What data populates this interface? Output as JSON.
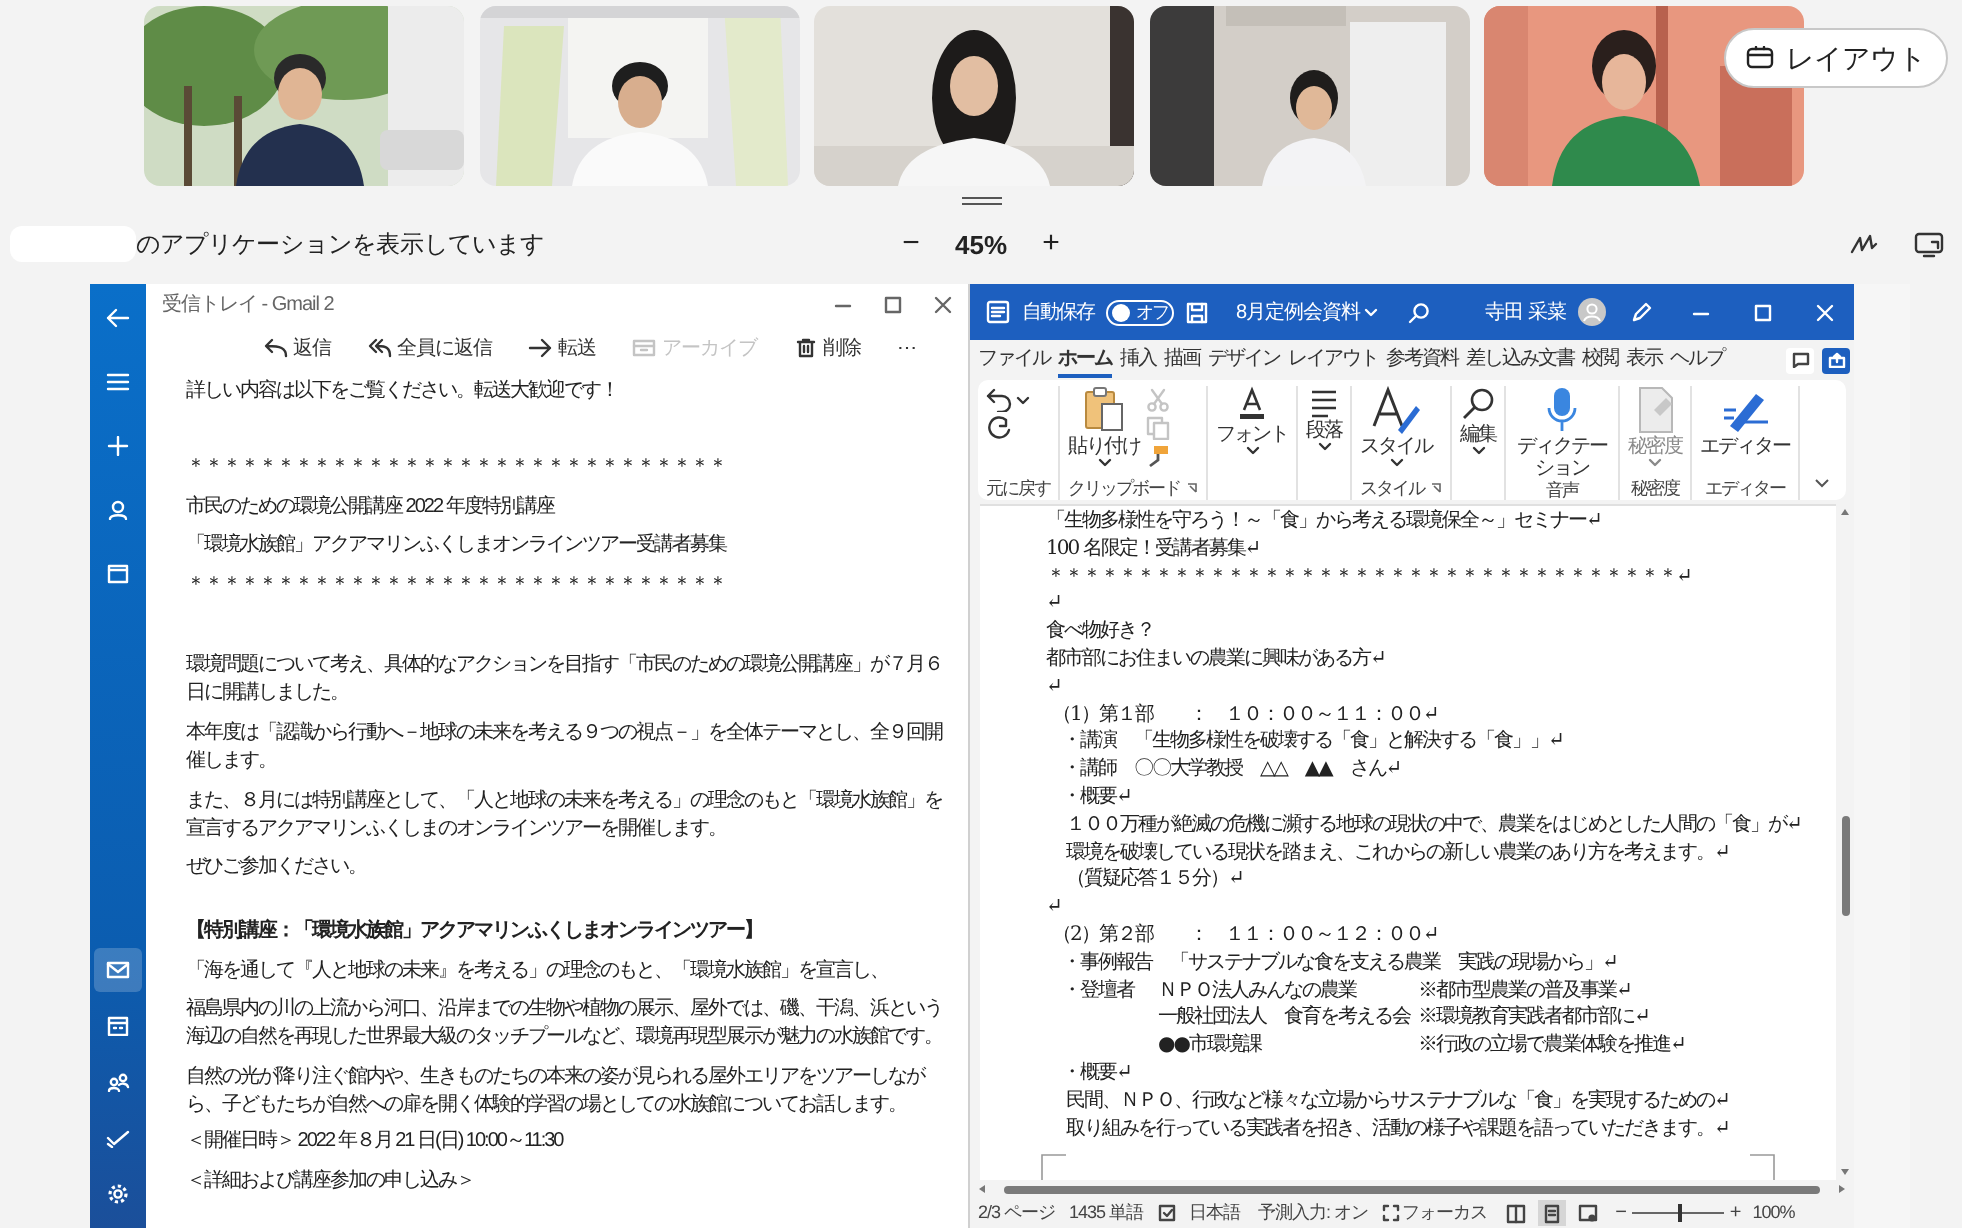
{
  "meeting": {
    "layout_button": "レイアウト",
    "share_bar": {
      "text": "のアプリケーションを表示しています",
      "zoom_out": "−",
      "zoom": "45%",
      "zoom_in": "+"
    }
  },
  "mail": {
    "title": "受信トレイ - Gmail 2",
    "sidebar": {
      "top_items": [
        {
          "kind": "back"
        },
        {
          "kind": "menu"
        },
        {
          "kind": "compose"
        },
        {
          "kind": "accounts"
        },
        {
          "kind": "folders"
        }
      ],
      "bottom_items": [
        {
          "kind": "mail",
          "selected": true
        },
        {
          "kind": "calendar",
          "selected": false
        },
        {
          "kind": "people",
          "selected": false
        },
        {
          "kind": "todo",
          "selected": false
        },
        {
          "kind": "settings",
          "selected": false
        }
      ]
    },
    "toolbar": [
      {
        "kind": "reply",
        "label": "返信",
        "disabled": false
      },
      {
        "kind": "reply-all",
        "label": "全員に返信",
        "disabled": false
      },
      {
        "kind": "forward",
        "label": "転送",
        "disabled": false
      },
      {
        "kind": "archive",
        "label": "アーカイブ",
        "disabled": true
      },
      {
        "kind": "delete",
        "label": "削除",
        "disabled": false
      },
      {
        "kind": "more",
        "label": "⋯",
        "disabled": false
      }
    ],
    "body": [
      {
        "kind": "text",
        "text": "詳しい内容は以下をご覧ください。転送大歓迎です！"
      },
      {
        "kind": "text",
        "text": "＊＊＊＊＊＊＊＊＊＊＊＊＊＊＊＊＊＊＊＊＊＊＊＊＊＊＊＊＊＊"
      },
      {
        "kind": "text",
        "text": "市民のための環境公開講座 2022 年度特別講座"
      },
      {
        "kind": "text",
        "text": "「環境水族館」アクアマリンふくしまオンラインツアー受講者募集"
      },
      {
        "kind": "text",
        "text": "＊＊＊＊＊＊＊＊＊＊＊＊＊＊＊＊＊＊＊＊＊＊＊＊＊＊＊＊＊＊"
      },
      {
        "kind": "text",
        "text": "環境問題について考え、具体的なアクションを目指す「市民のための環境公開講座」が７月６日に開講しました。"
      },
      {
        "kind": "text",
        "text": "本年度は「認識から行動へ－地球の未来を考える９つの視点－」を全体テーマとし、全９回開催します。"
      },
      {
        "kind": "text",
        "text": "また、８月には特別講座として、「人と地球の未来を考える」の理念のもと「環境水族館」を宣言するアクアマリンふくしまのオンラインツアーを開催します。"
      },
      {
        "kind": "text",
        "text": "ぜひご参加ください。"
      },
      {
        "kind": "heading",
        "text": "【特別講座：「環境水族館」アクアマリンふくしまオンラインツアー】"
      },
      {
        "kind": "text",
        "text": "「海を通して『人と地球の未来』を考える」の理念のもと、「環境水族館」を宣言し、"
      },
      {
        "kind": "text",
        "text": "福島県内の川の上流から河口、沿岸までの生物や植物の展示、屋外では、磯、干潟、浜という海辺の自然を再現した世界最大級のタッチプールなど、環境再現型展示が魅力の水族館です。"
      },
      {
        "kind": "text",
        "text": "自然の光が降り注ぐ館内や、生きものたちの本来の姿が見られる屋外エリアをツアーしながら、子どもたちが自然への扉を開く体験的学習の場としての水族館についてお話します。"
      },
      {
        "kind": "text",
        "text": "＜開催日時＞ 2022 年８月 21 日(日) 10:00～11:30"
      },
      {
        "kind": "text",
        "text": "＜詳細および講座参加の申し込み＞"
      }
    ]
  },
  "word": {
    "autosave": {
      "label": "自動保存",
      "on": false,
      "state": "オフ"
    },
    "doc_title": "8月定例会資料",
    "user": "寺田 采菜",
    "tabs": [
      {
        "label": "ファイル",
        "selected": false
      },
      {
        "label": "ホーム",
        "selected": true
      },
      {
        "label": "挿入",
        "selected": false
      },
      {
        "label": "描画",
        "selected": false
      },
      {
        "label": "デザイン",
        "selected": false
      },
      {
        "label": "レイアウト",
        "selected": false
      },
      {
        "label": "参考資料",
        "selected": false
      },
      {
        "label": "差し込み文書",
        "selected": false
      },
      {
        "label": "校閲",
        "selected": false
      },
      {
        "label": "表示",
        "selected": false
      },
      {
        "label": "ヘルプ",
        "selected": false
      }
    ],
    "ribbon": [
      {
        "label": "元に戻す",
        "launcher": false,
        "buttons": [
          {
            "kind": "undo",
            "dropdown": true,
            "disabled": false
          },
          {
            "kind": "redo",
            "dropdown": false,
            "disabled": false
          }
        ]
      },
      {
        "label": "クリップボード",
        "launcher": true,
        "buttons": [
          {
            "kind": "paste",
            "label": "貼り付け",
            "dropdown": true,
            "disabled": false
          },
          {
            "kind": "cut",
            "dropdown": false,
            "disabled": true
          },
          {
            "kind": "copy",
            "dropdown": false,
            "disabled": true
          },
          {
            "kind": "painter",
            "dropdown": false,
            "disabled": false
          }
        ]
      },
      {
        "launcher": false,
        "buttons": [
          {
            "kind": "font",
            "label": "フォント",
            "dropdown": true,
            "disabled": false
          }
        ]
      },
      {
        "launcher": false,
        "buttons": [
          {
            "kind": "paragraph",
            "label": "段落",
            "dropdown": true,
            "disabled": false
          }
        ]
      },
      {
        "label": "スタイル",
        "launcher": true,
        "buttons": [
          {
            "kind": "styles",
            "label": "スタイル",
            "dropdown": true,
            "disabled": false
          }
        ]
      },
      {
        "launcher": false,
        "buttons": [
          {
            "kind": "find",
            "label": "編集",
            "dropdown": true,
            "disabled": false
          }
        ]
      },
      {
        "label": "音声",
        "launcher": false,
        "buttons": [
          {
            "kind": "mic",
            "label": "ディクテーション",
            "dropdown": false,
            "disabled": false
          }
        ]
      },
      {
        "label": "秘密度",
        "launcher": false,
        "buttons": [
          {
            "kind": "sensitivity",
            "label": "秘密度",
            "dropdown": true,
            "disabled": true
          }
        ]
      },
      {
        "label": "エディター",
        "launcher": false,
        "buttons": [
          {
            "kind": "editor",
            "label": "エディター",
            "dropdown": false,
            "disabled": false
          }
        ]
      }
    ],
    "document": [
      {
        "kind": "plain",
        "text": "「生物多様性を守ろう！～「食」から考える環境保全～」セミナー↵"
      },
      {
        "kind": "plain",
        "text": "100 名限定！受講者募集↵"
      },
      {
        "kind": "plain",
        "text": "＊＊＊＊＊＊＊＊＊＊＊＊＊＊＊＊＊＊＊＊＊＊＊＊＊＊＊＊＊＊＊＊＊＊＊↵"
      },
      {
        "kind": "plain",
        "text": "↵"
      },
      {
        "kind": "plain",
        "text": "食べ物好き？"
      },
      {
        "kind": "plain",
        "text": "都市部にお住まいの農業に興味がある方↵"
      },
      {
        "kind": "plain",
        "text": "↵"
      },
      {
        "kind": "heading",
        "text": "（1）第１部　　：　１０：００～１１：００↵"
      },
      {
        "kind": "bullet",
        "text": "・講演　「生物多様性を破壊する「食」と解決する「食」」↵"
      },
      {
        "kind": "bullet",
        "text": "・講師　〇〇大学教授　△△　▲▲　さん↵"
      },
      {
        "kind": "bullet",
        "text": "・概要↵"
      },
      {
        "kind": "body",
        "text": "１００万種が絶滅の危機に瀕する地球の現状の中で、農業をはじめとした人間の「食」が↵"
      },
      {
        "kind": "body",
        "text": "環境を破壊している現状を踏まえ、これからの新しい農業のあり方を考えます。↵"
      },
      {
        "kind": "body",
        "text": "（質疑応答１５分）↵"
      },
      {
        "kind": "plain",
        "text": "↵"
      },
      {
        "kind": "heading",
        "text": "（2）第２部　　：　１１：００～１２：００↵"
      },
      {
        "kind": "bullet",
        "text": "・事例報告　「サステナブルな食を支える農業　実践の現場から」↵"
      },
      {
        "kind": "speaker",
        "label": "・登壇者",
        "org": "ＮＰＯ法人みんなの農業",
        "note": "※都市型農業の普及事業↵"
      },
      {
        "kind": "speaker",
        "org": "一般社団法人　食育を考える会",
        "note": "※環境教育実践者都市部に↵"
      },
      {
        "kind": "speaker",
        "org": "●●市環境課",
        "note": "※行政の立場で農業体験を推進↵"
      },
      {
        "kind": "bullet",
        "text": "・概要↵"
      },
      {
        "kind": "body",
        "text": "民間、ＮＰＯ、行政など様々な立場からサステナブルな「食」を実現するための↵"
      },
      {
        "kind": "body",
        "text": "取り組みを行っている実践者を招き、活動の様子や課題を語っていただきます。↵"
      }
    ],
    "status_bar": {
      "page": "2/3 ページ",
      "words": "1435 単語",
      "language": "日本語",
      "prediction": "予測入力: オン",
      "focus": "フォーカス",
      "views": [
        {
          "kind": "read",
          "selected": false
        },
        {
          "kind": "print",
          "selected": true
        },
        {
          "kind": "web",
          "selected": false
        }
      ],
      "zoom_out": "−",
      "zoom_slider": {
        "level": 0.52
      },
      "zoom_in": "+",
      "zoom": "100%"
    }
  }
}
